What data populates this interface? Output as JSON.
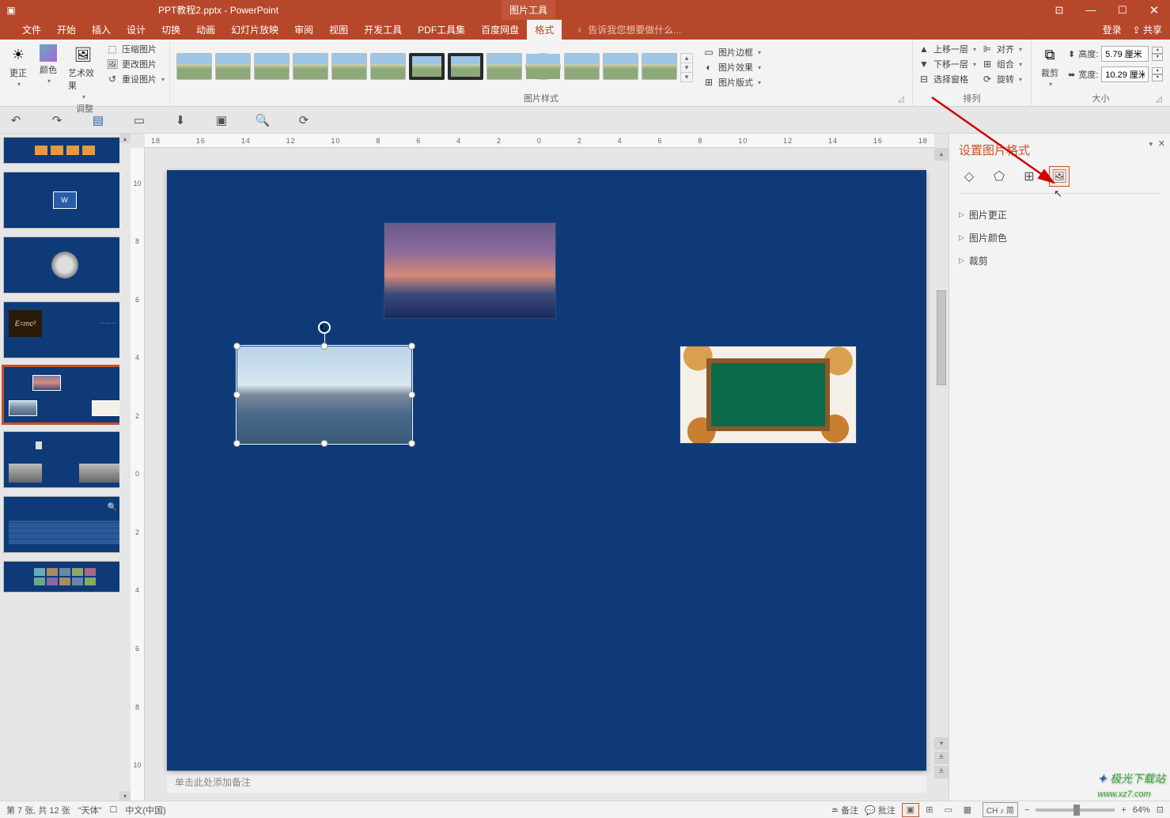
{
  "title_bar": {
    "document_name": "PPT教程2.pptx - PowerPoint",
    "context_tab": "图片工具"
  },
  "tabs": {
    "start": "开始",
    "insert": "插入",
    "design": "设计",
    "transition": "切换",
    "animation": "动画",
    "slideshow": "幻灯片放映",
    "review": "审阅",
    "view": "视图",
    "developer": "开发工具",
    "pdf_tools": "PDF工具集",
    "baidu_disk": "百度网盘",
    "format": "格式",
    "tell_me": "告诉我您想要做什么...",
    "login": "登录",
    "share": "共享"
  },
  "ribbon": {
    "adjust": {
      "remove_bg": "",
      "corrections": "更正",
      "color": "颜色",
      "artistic": "艺术效果",
      "compress": "压缩图片",
      "change": "更改图片",
      "reset": "重设图片",
      "label": "调整"
    },
    "styles": {
      "label": "图片样式"
    },
    "style_opts": {
      "border": "图片边框",
      "effects": "图片效果",
      "layout": "图片版式"
    },
    "arrange": {
      "bring_forward": "上移一层",
      "send_backward": "下移一层",
      "selection_pane": "选择窗格",
      "align": "对齐",
      "group": "组合",
      "rotate": "旋转",
      "label": "排列"
    },
    "size": {
      "crop": "裁剪",
      "height_label": "高度:",
      "height_value": "5.79 厘米",
      "width_label": "宽度:",
      "width_value": "10.29 厘米",
      "label": "大小"
    }
  },
  "ruler_marks": [
    "18",
    "16",
    "14",
    "12",
    "10",
    "8",
    "6",
    "4",
    "2",
    "0",
    "2",
    "4",
    "6",
    "8",
    "10",
    "12",
    "14",
    "16",
    "18"
  ],
  "ruler_v": [
    "10",
    "8",
    "6",
    "4",
    "2",
    "0",
    "2",
    "4",
    "6",
    "8",
    "10"
  ],
  "notes_placeholder": "单击此处添加备注",
  "format_pane": {
    "title": "设置图片格式",
    "sections": {
      "corrections": "图片更正",
      "color": "图片颜色",
      "crop": "裁剪"
    }
  },
  "status": {
    "slide_info": "第 7 张, 共 12 张",
    "layout_name": "\"天体\"",
    "language": "中文(中国)",
    "notes": "备注",
    "comments": "批注",
    "ime": "CH ♪ 简",
    "zoom": "64%"
  },
  "watermark": {
    "brand": "极光下载站",
    "url": "www.xz7.com"
  }
}
